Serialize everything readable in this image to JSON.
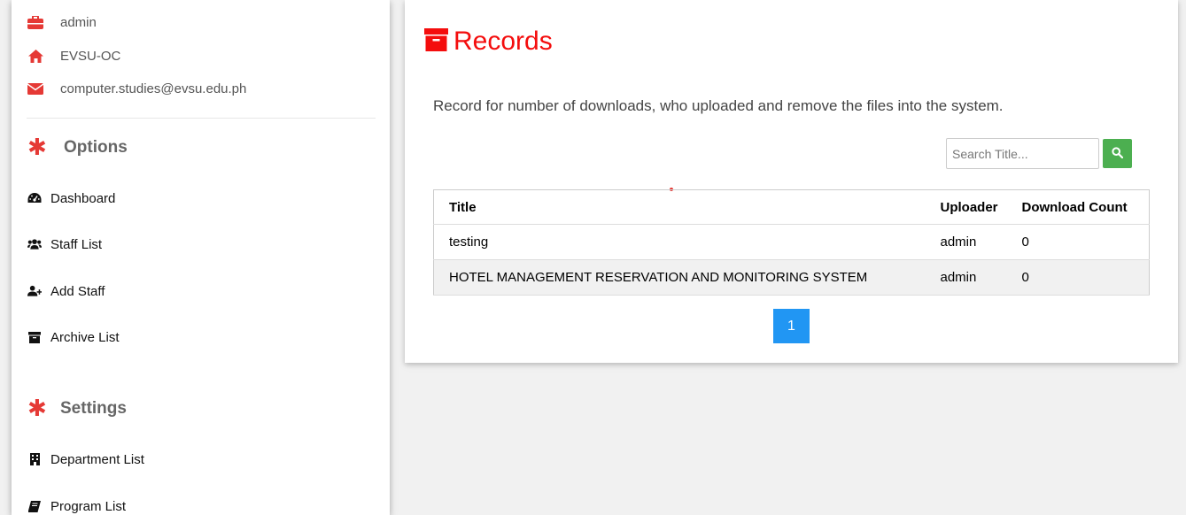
{
  "sidebar": {
    "info": [
      {
        "icon": "briefcase-icon",
        "text": "admin"
      },
      {
        "icon": "home-icon",
        "text": "EVSU-OC"
      },
      {
        "icon": "envelope-icon",
        "text": "computer.studies@evsu.edu.ph"
      }
    ],
    "sections": {
      "options": {
        "label": "Options",
        "items": [
          {
            "icon": "dashboard-icon",
            "label": "Dashboard"
          },
          {
            "icon": "users-icon",
            "label": "Staff List"
          },
          {
            "icon": "user-plus-icon",
            "label": "Add Staff"
          },
          {
            "icon": "archive-icon",
            "label": "Archive List"
          }
        ]
      },
      "settings": {
        "label": "Settings",
        "items": [
          {
            "icon": "building-icon",
            "label": "Department List"
          },
          {
            "icon": "book-icon",
            "label": "Program List"
          }
        ]
      }
    }
  },
  "main": {
    "title": "Records",
    "title_icon": "archive-icon",
    "description": "Record for number of downloads, who uploaded and remove the files into the system.",
    "search": {
      "placeholder": "Search Title...",
      "value": ""
    },
    "table": {
      "headers": [
        "Title",
        "Uploader",
        "Download Count"
      ],
      "rows": [
        [
          "testing",
          "admin",
          "0"
        ],
        [
          "HOTEL MANAGEMENT RESERVATION AND MONITORING SYSTEM",
          "admin",
          "0"
        ]
      ]
    },
    "pagination": {
      "current": "1"
    }
  },
  "colors": {
    "accent_red": "#f40d0d",
    "icon_red": "#e53935",
    "search_button": "#4caf50",
    "pager": "#2196f3"
  }
}
